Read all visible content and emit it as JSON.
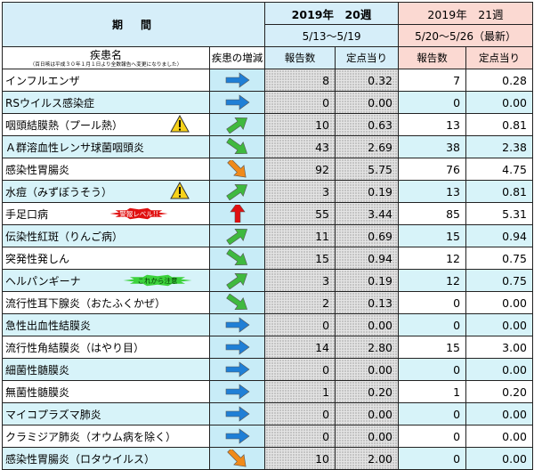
{
  "header": {
    "period_label": "期　間",
    "week20_title": "2019年　20週",
    "week20_range": "5/13〜5/19",
    "week21_title": "2019年　21週",
    "week21_range": "5/20〜5/26（最新）"
  },
  "columns": {
    "disease_label": "疾患名",
    "disease_note": "（百日咳は平成３０年１月１日より全数報告へ変更になりました）",
    "trend_label": "疾患の増減",
    "reports_20": "報告数",
    "per_site_20": "定点当り",
    "reports_21": "報告数",
    "per_site_21": "定点当り"
  },
  "badges": {
    "warning_level": "警報レベル!!",
    "attention": "これから注意"
  },
  "colors": {
    "header_blue": "#d6eef9",
    "header_pink": "#fbd9d2",
    "row_alt": "#d7f3f9",
    "arrow_blue": "#1f7fd6",
    "arrow_green": "#3fb93f",
    "arrow_orange": "#f08a1a",
    "arrow_red": "#e01010",
    "caution_yellow": "#f7d21a"
  },
  "rows": [
    {
      "name": "インフルエンザ",
      "trend": "flat",
      "r20": "8",
      "p20": "0.32",
      "r21": "7",
      "p21": "0.28"
    },
    {
      "name": "RSウイルス感染症",
      "trend": "flat",
      "r20": "0",
      "p20": "0.00",
      "r21": "0",
      "p21": "0.00"
    },
    {
      "name": "咽頭結膜熱（プール熱）",
      "trend": "up",
      "caution": true,
      "r20": "10",
      "p20": "0.63",
      "r21": "13",
      "p21": "0.81"
    },
    {
      "name": "Ａ群溶血性レンサ球菌咽頭炎",
      "trend": "down",
      "r20": "43",
      "p20": "2.69",
      "r21": "38",
      "p21": "2.38"
    },
    {
      "name": "感染性胃腸炎",
      "trend": "down-orange",
      "r20": "92",
      "p20": "5.75",
      "r21": "76",
      "p21": "4.75"
    },
    {
      "name": "水痘（みずぼうそう）",
      "trend": "up",
      "caution": true,
      "r20": "3",
      "p20": "0.19",
      "r21": "13",
      "p21": "0.81"
    },
    {
      "name": "手足口病",
      "trend": "up-red",
      "badge": "warning",
      "r20": "55",
      "p20": "3.44",
      "r21": "85",
      "p21": "5.31"
    },
    {
      "name": "伝染性紅斑（りんご病）",
      "trend": "up",
      "r20": "11",
      "p20": "0.69",
      "r21": "15",
      "p21": "0.94"
    },
    {
      "name": "突発性発しん",
      "trend": "down",
      "r20": "15",
      "p20": "0.94",
      "r21": "12",
      "p21": "0.75"
    },
    {
      "name": "ヘルパンギーナ",
      "trend": "up",
      "badge": "attention",
      "r20": "3",
      "p20": "0.19",
      "r21": "12",
      "p21": "0.75"
    },
    {
      "name": "流行性耳下腺炎（おたふくかぜ）",
      "trend": "down",
      "r20": "2",
      "p20": "0.13",
      "r21": "0",
      "p21": "0.00"
    },
    {
      "name": "急性出血性結膜炎",
      "trend": "flat",
      "r20": "0",
      "p20": "0.00",
      "r21": "0",
      "p21": "0.00"
    },
    {
      "name": "流行性角結膜炎（はやり目）",
      "trend": "flat",
      "r20": "14",
      "p20": "2.80",
      "r21": "15",
      "p21": "3.00"
    },
    {
      "name": "細菌性髄膜炎",
      "trend": "flat",
      "r20": "0",
      "p20": "0.00",
      "r21": "0",
      "p21": "0.00"
    },
    {
      "name": "無菌性髄膜炎",
      "trend": "flat",
      "r20": "1",
      "p20": "0.20",
      "r21": "1",
      "p21": "0.20"
    },
    {
      "name": "マイコプラズマ肺炎",
      "trend": "flat",
      "r20": "0",
      "p20": "0.00",
      "r21": "0",
      "p21": "0.00"
    },
    {
      "name": "クラミジア肺炎（オウム病を除く）",
      "trend": "flat",
      "r20": "0",
      "p20": "0.00",
      "r21": "0",
      "p21": "0.00"
    },
    {
      "name": "感染性胃腸炎（ロタウイルス）",
      "trend": "down-orange",
      "r20": "10",
      "p20": "2.00",
      "r21": "0",
      "p21": "0.00"
    }
  ]
}
